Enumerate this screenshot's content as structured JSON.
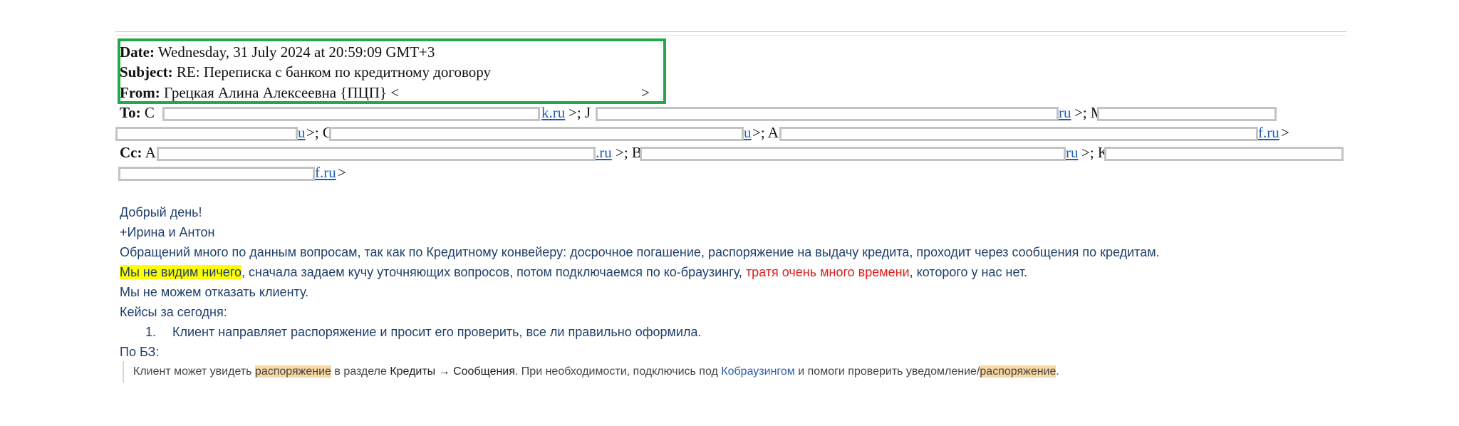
{
  "header": {
    "date_label": "Date:",
    "date_value": "Wednesday, 31 July 2024 at 20:59:09 GMT+3",
    "subject_label": "Subject:",
    "subject_value": "RE: Переписка с банком по кредитному договору",
    "from_label": "From:",
    "from_value": "Грецкая Алина Алексеевна {ПЦП}",
    "from_open": "<",
    "from_close": ">",
    "to_label": "To:",
    "to_start": "C",
    "to_fragment1": "k.ru",
    "to_sep1": ">; J",
    "to_fragment2": "ru",
    "to_sep2": ">; M",
    "to_line2_fragment1": "u",
    "to_line2_sep1": ">; C",
    "to_line2_fragment2": "u",
    "to_line2_sep2": ">; A",
    "to_line2_fragment3": "f.ru",
    "to_line2_end": ">",
    "cc_label": "Cc:",
    "cc_start": "A",
    "cc_fragment1": ".ru",
    "cc_sep1": ">; B",
    "cc_fragment2": "ru",
    "cc_sep2": ">; K",
    "cc_line2_fragment": "f.ru",
    "cc_line2_end": ">"
  },
  "body": {
    "greeting": "Добрый день!",
    "cc_note": "+Ирина и Антон",
    "line1": "Обращений много по данным вопросам, так как по Кредитному конвейеру: досрочное погашение, распоряжение на выдачу кредита, проходит через сообщения по кредитам.",
    "line2_highlight": "Мы не видим ничего",
    "line2_middle": ", сначала задаем кучу уточняющих вопросов, потом подключаемся по ко-браузингу, ",
    "line2_red": "тратя очень много времени",
    "line2_end": ", которого у нас нет.",
    "line3": "Мы не можем отказать клиенту.",
    "cases_title": "Кейсы за сегодня:",
    "case1_number": "1.",
    "case1_text": "Клиент направляет распоряжение и просит его проверить, все ли правильно оформила.",
    "kb_title": "По БЗ:"
  },
  "kb_quote": {
    "p1": "Клиент может увидеть ",
    "hl1": "распоряжение",
    "p2": " в разделе ",
    "strong": "Кредиты → Сообщения",
    "p3": ". При необходимости, подключись под ",
    "link": "Кобраузингом",
    "p4": " и помоги проверить уведомление/",
    "hl2": "распоряжение",
    "p5": "."
  },
  "colors": {
    "highlight_box": "#23a84a",
    "body_text": "#1f3f6b",
    "red_text": "#e01b1b",
    "yellow_highlight": "#ffff00",
    "link": "#1f5fb3"
  }
}
